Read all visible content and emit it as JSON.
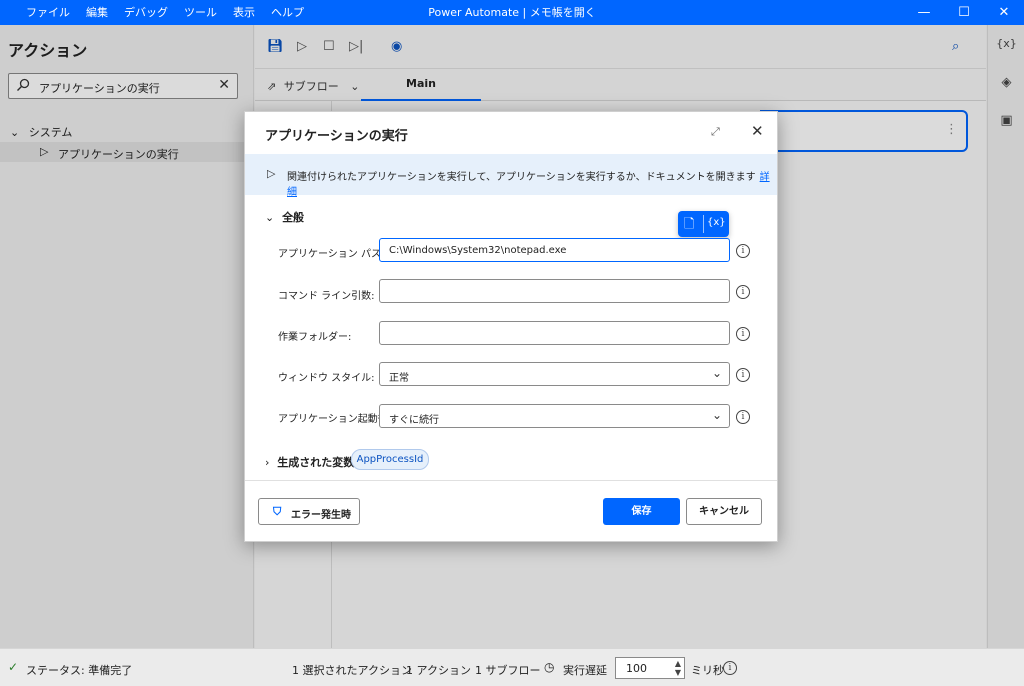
{
  "titlebar": {
    "menu": [
      "ファイル",
      "編集",
      "デバッグ",
      "ツール",
      "表示",
      "ヘルプ"
    ],
    "title": "Power Automate | メモ帳を開く",
    "controls": {
      "minimize": "—",
      "maximize": "☐",
      "close": "✕"
    }
  },
  "actions_panel": {
    "title": "アクション",
    "search_value": "アプリケーションの実行",
    "tree_group": "システム",
    "tree_item": "アプリケーションの実行"
  },
  "main": {
    "subflow_label": "サブフロー",
    "tab_main": "Main"
  },
  "right_rail": {
    "variables_label": "{x}"
  },
  "dialog": {
    "title": "アプリケーションの実行",
    "info_text": "関連付けられたアプリケーションを実行して、アプリケーションを実行するか、ドキュメントを開きます",
    "info_link": "詳細",
    "section_general": "全般",
    "picker_var_label": "{x}",
    "fields": {
      "app_path_label": "アプリケーション パス:",
      "app_path_value": "C:\\Windows\\System32\\notepad.exe",
      "cmd_args_label": "コマンド ライン引数:",
      "cmd_args_value": "",
      "work_folder_label": "作業フォルダー:",
      "work_folder_value": "",
      "window_style_label": "ウィンドウ スタイル:",
      "window_style_value": "正常",
      "after_launch_label": "アプリケーション起動後:",
      "after_launch_value": "すぐに続行"
    },
    "generated_vars_label": "生成された変数",
    "generated_var_chip": "AppProcessId",
    "error_button": "エラー発生時",
    "save_button": "保存",
    "cancel_button": "キャンセル"
  },
  "statusbar": {
    "status": "ステータス: 準備完了",
    "selected_actions": "1 選択されたアクション",
    "action_count": "1 アクション",
    "subflow_count": "1 サブフロー",
    "delay_label": "実行遅延",
    "delay_value": "100",
    "delay_unit": "ミリ秒"
  },
  "colors": {
    "accent": "#0066ff",
    "info_bg": "#e6f0fb"
  }
}
